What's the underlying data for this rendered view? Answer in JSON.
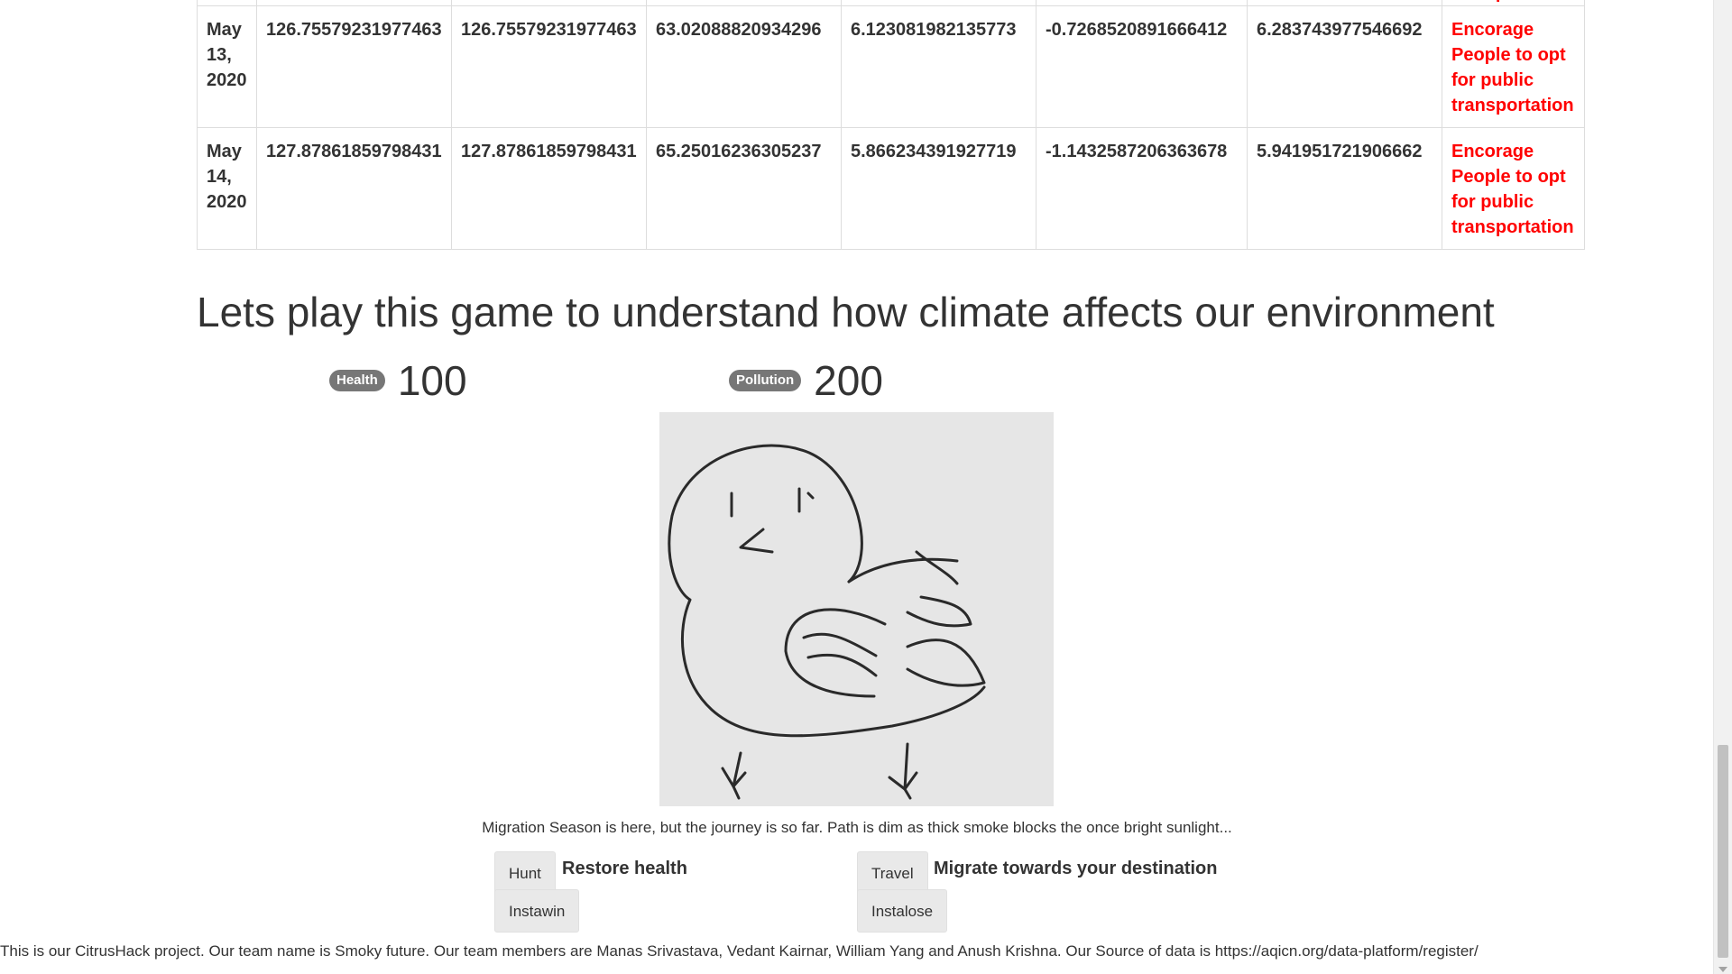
{
  "table": {
    "partial_row": {
      "recommendation": "transportation"
    },
    "rows": [
      {
        "date": "May 13, 2020",
        "c1": "126.75579231977463",
        "c2": "126.75579231977463",
        "c3": "63.02088820934296",
        "c4": "6.123081982135773",
        "c5": "-0.7268520891666412",
        "c6": "6.283743977546692",
        "recommendation": "Encorage People to opt for public transportation"
      },
      {
        "date": "May 14, 2020",
        "c1": "127.87861859798431",
        "c2": "127.87861859798431",
        "c3": "65.25016236305237",
        "c4": "5.866234391927719",
        "c5": "-1.1432587206363678",
        "c6": "5.941951721906662",
        "recommendation": "Encorage People to opt for public transportation"
      }
    ]
  },
  "game": {
    "heading": "Lets play this game to understand how climate affects our environment",
    "health_label": "Health",
    "health_value": "100",
    "pollution_label": "Pollution",
    "pollution_value": "200",
    "story": "Migration Season is here, but the journey is so far. Path is dim as thick smoke blocks the once bright sunlight...",
    "hunt_label": "Hunt",
    "hunt_desc": "Restore health",
    "travel_label": "Travel",
    "travel_desc": "Migrate towards your destination",
    "instawin_label": "Instawin",
    "instalose_label": "Instalose",
    "image_icon": "bird-drawing"
  },
  "footer": {
    "text": "This is our CitrusHack project. Our team name is Smoky future. Our team members are Manas Srivastava, Vedant Kairnar, William Yang and Anush Krishna. Our Source of data is https://aqicn.org/data-platform/register/"
  },
  "colors": {
    "recommendation": "#ff0000",
    "badge": "#777777",
    "button_bg": "#e9e9e9"
  }
}
